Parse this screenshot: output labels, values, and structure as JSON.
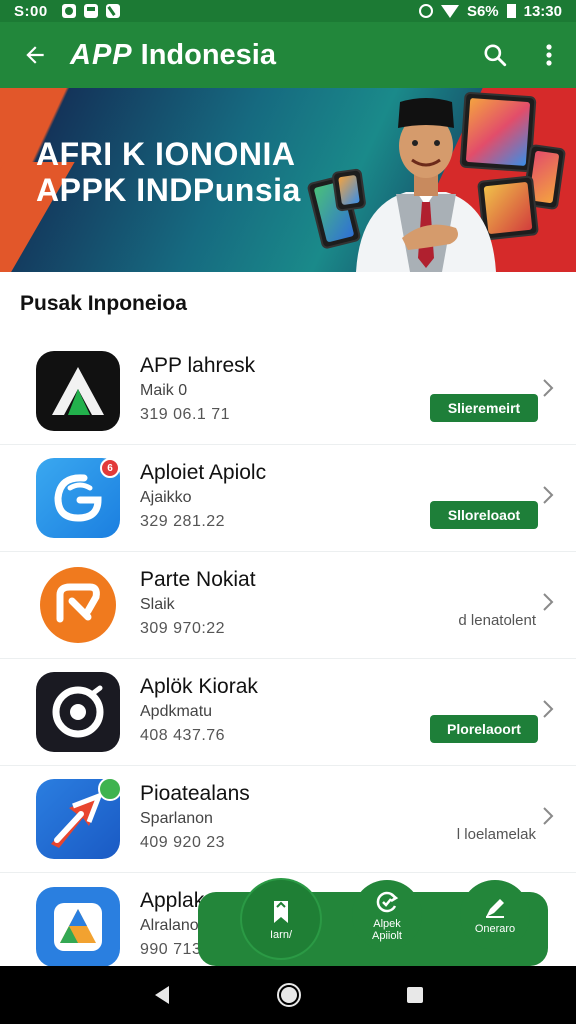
{
  "status_bar": {
    "time_left": "S:00",
    "battery": "S6%",
    "time_right": "13:30"
  },
  "app_bar": {
    "logo_app": "APP",
    "logo_text": "Indonesia"
  },
  "banner": {
    "line1": "AFRI K IONONIA",
    "line2": "APPK INDPunsia"
  },
  "section": {
    "title": "Pusak Inponeioa"
  },
  "apps": [
    {
      "name": "APP lahresk",
      "sub": "Maik 0",
      "meta": "319 06.1 71",
      "action": "Slieremeirt",
      "action_style": "button",
      "icon": "a-logo-icon"
    },
    {
      "name": "Aploiet Apiolc",
      "sub": "Ajaikko",
      "meta": "329 281.22",
      "action": "Slloreloaot",
      "action_style": "button",
      "icon": "g-swirl-icon",
      "badge": "6"
    },
    {
      "name": "Parte Nokiat",
      "sub": "Slaik",
      "meta": "309 970:22",
      "action": "d lenatolent",
      "action_style": "text",
      "icon": "arrow-circle-icon"
    },
    {
      "name": "Aplök Kiorak",
      "sub": "Apdkmatu",
      "meta": "408 437.76",
      "action": "Plorelaoort",
      "action_style": "button",
      "icon": "lens-icon"
    },
    {
      "name": "Pioatealans",
      "sub": "Sparlanon",
      "meta": "409 920 23",
      "action": "l loelamelak",
      "action_style": "text",
      "icon": "rocket-arrow-icon"
    },
    {
      "name": "Applak",
      "sub": "Alralano",
      "meta": "990 713 1",
      "action": "",
      "action_style": "none",
      "icon": "triangle-logo-icon"
    }
  ],
  "bottom_nav": [
    {
      "label": "Iarn/",
      "icon": "bookmark-arrow-icon"
    },
    {
      "label": "Alpek Apiiolt",
      "icon": "refresh-icon"
    },
    {
      "label": "Oneraro",
      "icon": "pen-icon"
    }
  ],
  "colors": {
    "primary": "#22873b",
    "status": "#1c7a34",
    "button": "#1e7f39"
  }
}
